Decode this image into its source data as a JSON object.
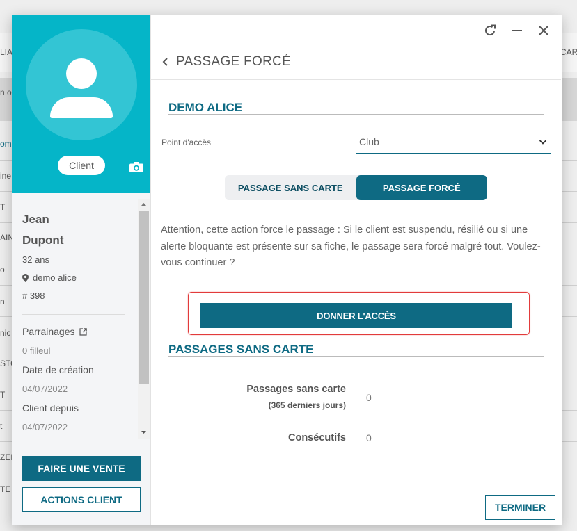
{
  "background": {
    "left_fragments": [
      "LIA",
      "n o",
      "om",
      "ine",
      "T",
      "AIN",
      "o",
      "n",
      "nic",
      "STO",
      "T",
      "t",
      "ZER",
      "TE"
    ],
    "right_fragments": [
      "CAR"
    ]
  },
  "colors": {
    "brand_dark": "#0e6a83",
    "brand_cyan": "#05b5c8",
    "highlight_red": "#e23b3b"
  },
  "client": {
    "badge": "Client",
    "first_name": "Jean",
    "last_name": "Dupont",
    "age": "32 ans",
    "location": "demo alice",
    "number": "# 398",
    "referrals_label": "Parrainages",
    "referrals_value": "0 filleul",
    "created_label": "Date de création",
    "created_value": "04/07/2022",
    "since_label": "Client depuis",
    "since_value": "04/07/2022"
  },
  "left_actions": {
    "sale": "FAIRE UNE VENTE",
    "actions": "ACTIONS CLIENT"
  },
  "header": {
    "title": "PASSAGE FORCÉ"
  },
  "section1": {
    "title": "DEMO ALICE",
    "access_label": "Point d'accès",
    "access_value": "Club"
  },
  "toggle": {
    "option_a": "PASSAGE SANS CARTE",
    "option_b": "PASSAGE FORCÉ",
    "selected": "PASSAGE FORCÉ"
  },
  "warning_text": "Attention, cette action force le passage : Si le client est suspendu, résilié ou si une alerte bloquante est présente sur sa fiche, le passage sera forcé malgré tout. Voulez-vous continuer ?",
  "give_access": "DONNER L'ACCÈS",
  "section2": {
    "title": "PASSAGES SANS CARTE",
    "stat1_label": "Passages sans carte",
    "stat1_sub": "(365 derniers jours)",
    "stat1_value": "0",
    "stat2_label": "Consécutifs",
    "stat2_value": "0"
  },
  "footer": {
    "finish": "TERMINER"
  }
}
